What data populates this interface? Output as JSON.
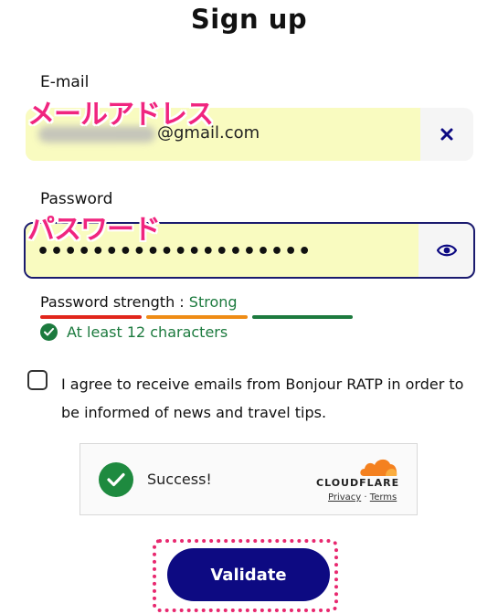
{
  "page": {
    "title": "Sign up"
  },
  "email": {
    "label": "E-mail",
    "annotation": "メールアドレス",
    "value": "@gmail.com",
    "clear_icon": "close-icon"
  },
  "password": {
    "label": "Password",
    "annotation": "パスワード",
    "value": "••••••••••••••••••••",
    "toggle_icon": "eye-icon",
    "strength_label": "Password strength :",
    "strength_value": "Strong",
    "strength_colors": [
      "#e1251b",
      "#ef8c15",
      "#1c7a3e"
    ],
    "requirement": "At least 12 characters"
  },
  "consent": {
    "text": "I agree to receive emails from Bonjour RATP in order to be informed of news and travel tips."
  },
  "captcha": {
    "status": "Success!",
    "brand": "CLOUDFLARE",
    "privacy": "Privacy",
    "separator": "·",
    "terms": "Terms"
  },
  "actions": {
    "validate": "Validate"
  },
  "colors": {
    "accent": "#0d0a82",
    "highlight": "#f9fbc0",
    "annotation": "#f0257f",
    "success": "#1c7a3e"
  }
}
